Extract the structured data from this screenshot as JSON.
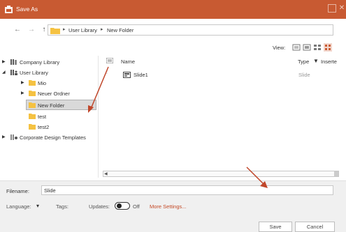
{
  "window": {
    "title": "Save As"
  },
  "nav": {
    "path": [
      "User Library",
      "New Folder"
    ]
  },
  "view": {
    "label": "View:"
  },
  "tree": {
    "items": [
      {
        "label": "Company Library",
        "expanded": false,
        "icon": "library-icon"
      },
      {
        "label": "User Library",
        "expanded": true,
        "icon": "user-library-icon"
      },
      {
        "label": "Mio",
        "expanded": false,
        "icon": "folder-icon"
      },
      {
        "label": "Neuer Ordner",
        "expanded": false,
        "icon": "folder-icon"
      },
      {
        "label": "New Folder",
        "selected": true,
        "icon": "folder-icon"
      },
      {
        "label": "test",
        "icon": "folder-icon"
      },
      {
        "label": "test2",
        "icon": "folder-icon"
      },
      {
        "label": "Corporate Design Templates",
        "expanded": false,
        "icon": "templates-icon"
      }
    ]
  },
  "files": {
    "columns": {
      "name": "Name",
      "type": "Type",
      "insert": "Inserte"
    },
    "rows": [
      {
        "name": "Slide1",
        "type": "Slide"
      }
    ]
  },
  "bottom": {
    "filename_label": "Filename:",
    "filename_value": "Slide",
    "language_label": "Language:",
    "tags_label": "Tags:",
    "updates_label": "Updates:",
    "updates_state": "Off",
    "more_settings": "More Settings...",
    "save": "Save",
    "cancel": "Cancel"
  },
  "colors": {
    "titlebar": "#c85a32",
    "accent": "#c44a27",
    "folder": "#f5c242",
    "annotation_arrow": "#c0462a"
  }
}
